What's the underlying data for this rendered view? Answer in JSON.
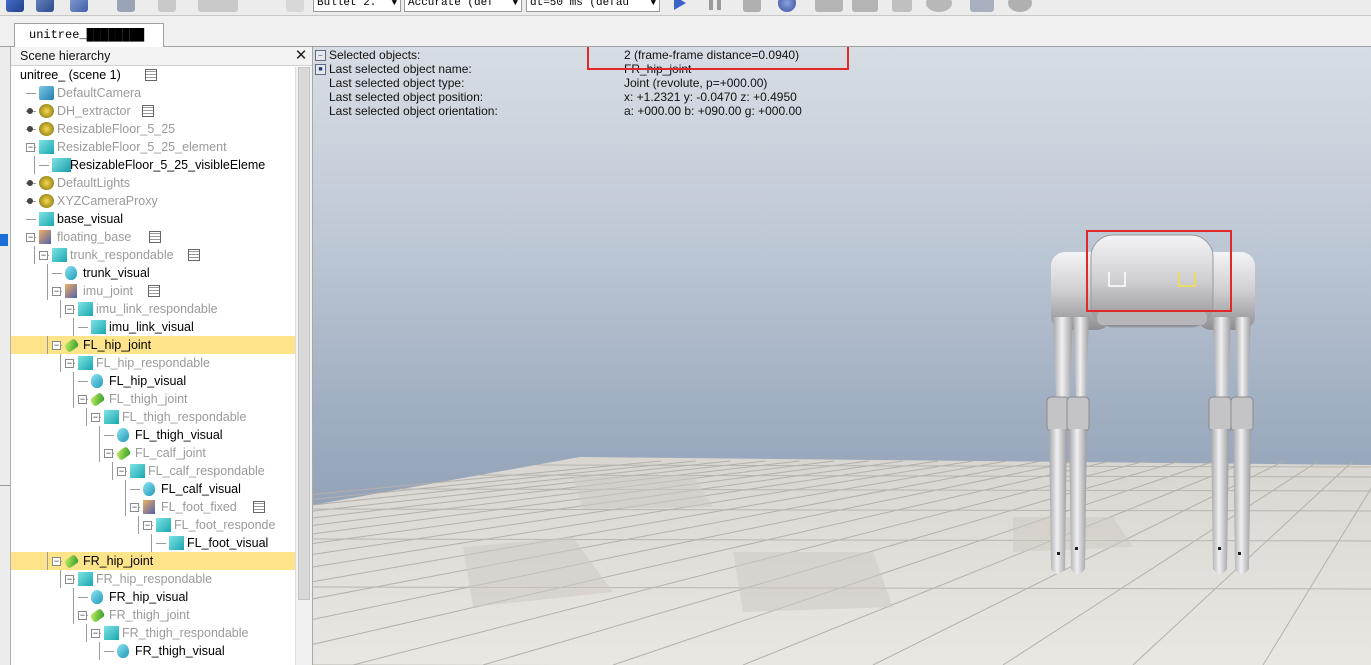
{
  "toolbar": {
    "engine_select": "Bullet 2.",
    "accuracy_select": "Accurate (def",
    "dt_select": "dt=50 ms (defau"
  },
  "tabs": [
    {
      "label": "unitree_████████"
    }
  ],
  "hierarchy": {
    "title": "Scene hierarchy",
    "close": "✕",
    "items": [
      {
        "label": "unitree_ (scene 1)",
        "type": "scene",
        "dim": false,
        "selected": false
      },
      {
        "label": "DefaultCamera",
        "type": "camera",
        "dim": true,
        "selected": false
      },
      {
        "label": "DH_extractor",
        "type": "dummy",
        "dim": true,
        "selected": false
      },
      {
        "label": "ResizableFloor_5_25",
        "type": "dummy",
        "dim": true,
        "selected": false
      },
      {
        "label": "ResizableFloor_5_25_element",
        "type": "shape",
        "dim": true,
        "selected": false
      },
      {
        "label": "ResizableFloor_5_25_visibleEleme",
        "type": "shape-pair",
        "dim": false,
        "selected": false
      },
      {
        "label": "DefaultLights",
        "type": "dummy",
        "dim": true,
        "selected": false
      },
      {
        "label": "XYZCameraProxy",
        "type": "dummy",
        "dim": true,
        "selected": false
      },
      {
        "label": "base_visual",
        "type": "shape",
        "dim": false,
        "selected": false
      },
      {
        "label": "floating_base",
        "type": "force",
        "dim": true,
        "selected": false
      },
      {
        "label": "trunk_respondable",
        "type": "shape",
        "dim": true,
        "selected": false
      },
      {
        "label": "trunk_visual",
        "type": "drop",
        "dim": false,
        "selected": false
      },
      {
        "label": "imu_joint",
        "type": "force",
        "dim": true,
        "selected": false
      },
      {
        "label": "imu_link_respondable",
        "type": "shape",
        "dim": true,
        "selected": false
      },
      {
        "label": "imu_link_visual",
        "type": "shape",
        "dim": false,
        "selected": false
      },
      {
        "label": "FL_hip_joint",
        "type": "joint",
        "dim": false,
        "selected": true
      },
      {
        "label": "FL_hip_respondable",
        "type": "shape",
        "dim": true,
        "selected": false
      },
      {
        "label": "FL_hip_visual",
        "type": "drop",
        "dim": false,
        "selected": false
      },
      {
        "label": "FL_thigh_joint",
        "type": "joint",
        "dim": true,
        "selected": false
      },
      {
        "label": "FL_thigh_respondable",
        "type": "shape",
        "dim": true,
        "selected": false
      },
      {
        "label": "FL_thigh_visual",
        "type": "drop",
        "dim": false,
        "selected": false
      },
      {
        "label": "FL_calf_joint",
        "type": "joint",
        "dim": true,
        "selected": false
      },
      {
        "label": "FL_calf_respondable",
        "type": "shape",
        "dim": true,
        "selected": false
      },
      {
        "label": "FL_calf_visual",
        "type": "drop",
        "dim": false,
        "selected": false
      },
      {
        "label": "FL_foot_fixed",
        "type": "force",
        "dim": true,
        "selected": false
      },
      {
        "label": "FL_foot_responde",
        "type": "shape",
        "dim": true,
        "selected": false
      },
      {
        "label": "FL_foot_visual",
        "type": "shape",
        "dim": false,
        "selected": false
      },
      {
        "label": "FR_hip_joint",
        "type": "joint",
        "dim": false,
        "selected": true
      },
      {
        "label": "FR_hip_respondable",
        "type": "shape",
        "dim": true,
        "selected": false
      },
      {
        "label": "FR_hip_visual",
        "type": "drop",
        "dim": false,
        "selected": false
      },
      {
        "label": "FR_thigh_joint",
        "type": "joint",
        "dim": true,
        "selected": false
      },
      {
        "label": "FR_thigh_respondable",
        "type": "shape",
        "dim": true,
        "selected": false
      },
      {
        "label": "FR_thigh_visual",
        "type": "drop",
        "dim": false,
        "selected": false
      }
    ]
  },
  "info": {
    "rows": [
      {
        "key": "Selected objects:",
        "value": "2 (frame-frame distance=0.0940)"
      },
      {
        "key": "Last selected object name:",
        "value": "FR_hip_joint"
      },
      {
        "key": "Last selected object type:",
        "value": "Joint (revolute, p=+000.00)"
      },
      {
        "key": "Last selected object position:",
        "value": "x: +1.2321    y: -0.0470    z: +0.4950"
      },
      {
        "key": "Last selected object orientation:",
        "value": "a: +000.00    b: +090.00    g: +000.00"
      }
    ]
  },
  "colors": {
    "selection_highlight": "#fde48a",
    "annotation_red": "#e3282a",
    "sky_top": "#d7dde4",
    "sky_bottom": "#7f8fa8",
    "floor_light": "#e6e3de",
    "floor_dark": "#cfcbc5",
    "dim_text": "#9a9a9a",
    "robot_body": "#d4d4d6"
  },
  "icons": {
    "toolbar": [
      "select-icon",
      "move-icon",
      "rotate-icon",
      "save-icon",
      "undo-icon",
      "redo-icon",
      "play-icon",
      "pause-icon",
      "stop-icon",
      "realtime-icon",
      "turtle-icon",
      "rabbit-icon",
      "visual-icon",
      "eye-icon",
      "page-icon",
      "gear-icon"
    ]
  }
}
